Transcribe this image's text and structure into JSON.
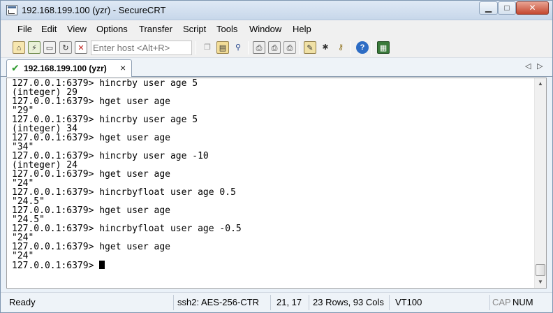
{
  "window": {
    "title": "192.168.199.100 (yzr) - SecureCRT",
    "minimize_icon": "minimize-icon",
    "maximize_icon": "maximize-icon",
    "close_icon": "close-icon"
  },
  "menu": {
    "items": [
      "File",
      "Edit",
      "View",
      "Options",
      "Transfer",
      "Script",
      "Tools",
      "Window",
      "Help"
    ]
  },
  "toolbar": {
    "host_placeholder": "Enter host <Alt+R>",
    "icons": [
      "connect-icon",
      "quick-connect-icon",
      "connect-in-tab-icon",
      "reconnect-icon",
      "disconnect-icon",
      "copy-icon",
      "paste-icon",
      "find-icon",
      "print-icon",
      "print-selection-icon",
      "print-setup-icon",
      "session-options-icon",
      "global-options-icon",
      "keymap-icon",
      "help-icon",
      "sftp-icon"
    ]
  },
  "tab": {
    "label": "192.168.199.100 (yzr)",
    "status_icon": "connected-check-icon",
    "close_symbol": "×"
  },
  "terminal": {
    "lines": [
      "127.0.0.1:6379> hincrby user age 5",
      "(integer) 29",
      "127.0.0.1:6379> hget user age",
      "\"29\"",
      "127.0.0.1:6379> hincrby user age 5",
      "(integer) 34",
      "127.0.0.1:6379> hget user age",
      "\"34\"",
      "127.0.0.1:6379> hincrby user age -10",
      "(integer) 24",
      "127.0.0.1:6379> hget user age",
      "\"24\"",
      "127.0.0.1:6379> hincrbyfloat user age 0.5",
      "\"24.5\"",
      "127.0.0.1:6379> hget user age",
      "\"24.5\"",
      "127.0.0.1:6379> hincrbyfloat user age -0.5",
      "\"24\"",
      "127.0.0.1:6379> hget user age",
      "\"24\"",
      "127.0.0.1:6379> "
    ]
  },
  "status": {
    "ready": "Ready",
    "cipher": "ssh2: AES-256-CTR",
    "position": "21,  17",
    "size": "23 Rows, 93 Cols",
    "terminal_type": "VT100",
    "cap": "CAP",
    "num": "NUM"
  }
}
